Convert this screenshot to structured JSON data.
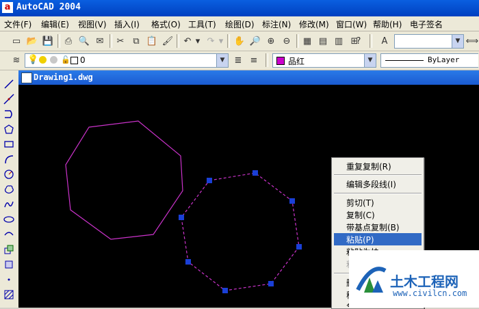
{
  "window": {
    "title": "AutoCAD 2004"
  },
  "menu": [
    "文件(F)",
    "编辑(E)",
    "视图(V)",
    "插入(I)",
    "格式(O)",
    "工具(T)",
    "绘图(D)",
    "标注(N)",
    "修改(M)",
    "窗口(W)",
    "帮助(H)",
    "电子签名"
  ],
  "layer": {
    "current": "0"
  },
  "color_control": {
    "value": "品红",
    "swatch": "#cc00cc"
  },
  "linetype_control": {
    "value": "ByLayer"
  },
  "document": {
    "title": "Drawing1.dwg"
  },
  "context_menu": {
    "items": [
      {
        "label": "重复复制(R)",
        "disabled": false,
        "highlighted": false
      },
      {
        "label": "编辑多段线(I)",
        "disabled": false,
        "highlighted": false
      },
      {
        "label": "剪切(T)",
        "disabled": false,
        "highlighted": false
      },
      {
        "label": "复制(C)",
        "disabled": false,
        "highlighted": false
      },
      {
        "label": "带基点复制(B)",
        "disabled": false,
        "highlighted": false
      },
      {
        "label": "粘贴(P)",
        "disabled": false,
        "highlighted": true
      },
      {
        "label": "粘贴为块",
        "disabled": false,
        "highlighted": false
      },
      {
        "label": "粘",
        "disabled": true,
        "highlighted": false
      },
      {
        "label": "删",
        "disabled": false,
        "highlighted": false
      },
      {
        "label": "移",
        "disabled": false,
        "highlighted": false
      },
      {
        "label": "复",
        "disabled": false,
        "highlighted": false
      }
    ]
  },
  "watermark": {
    "name": "土木工程网",
    "url": "www.civilcn.com"
  },
  "colors": {
    "magenta": "#cc33cc",
    "grip": "#1a3fd6",
    "canvas": "#000000",
    "highlight": "#316ac5"
  }
}
